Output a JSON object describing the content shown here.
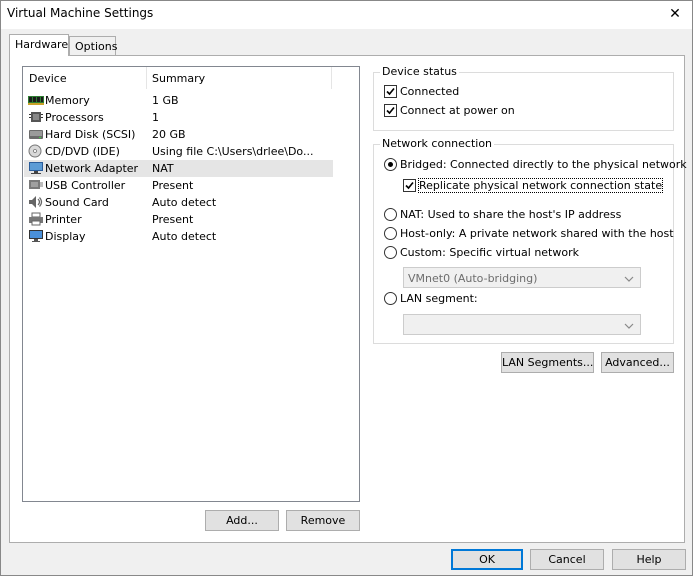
{
  "window": {
    "title": "Virtual Machine Settings",
    "close_glyph": "✕"
  },
  "tabs": [
    {
      "label": "Hardware",
      "active": true
    },
    {
      "label": "Options",
      "active": false
    }
  ],
  "device_list": {
    "columns": [
      "Device",
      "Summary"
    ],
    "rows": [
      {
        "device": "Memory",
        "summary": "1 GB",
        "icon": "memory-icon"
      },
      {
        "device": "Processors",
        "summary": "1",
        "icon": "processor-icon"
      },
      {
        "device": "Hard Disk (SCSI)",
        "summary": "20 GB",
        "icon": "hard-disk-icon"
      },
      {
        "device": "CD/DVD (IDE)",
        "summary": "Using file C:\\Users\\drlee\\Do...",
        "icon": "cd-dvd-icon"
      },
      {
        "device": "Network Adapter",
        "summary": "NAT",
        "icon": "network-adapter-icon",
        "selected": true
      },
      {
        "device": "USB Controller",
        "summary": "Present",
        "icon": "usb-controller-icon"
      },
      {
        "device": "Sound Card",
        "summary": "Auto detect",
        "icon": "sound-card-icon"
      },
      {
        "device": "Printer",
        "summary": "Present",
        "icon": "printer-icon"
      },
      {
        "device": "Display",
        "summary": "Auto detect",
        "icon": "display-icon"
      }
    ],
    "add_label": "Add...",
    "remove_label": "Remove"
  },
  "device_status": {
    "title": "Device status",
    "connected": {
      "label": "Connected",
      "checked": true
    },
    "connect_at_power_on": {
      "label": "Connect at power on",
      "checked": true
    }
  },
  "network_connection": {
    "title": "Network connection",
    "bridged": {
      "label": "Bridged: Connected directly to the physical network",
      "selected": true
    },
    "replicate": {
      "label": "Replicate physical network connection state",
      "checked": true
    },
    "nat": {
      "label": "NAT: Used to share the host's IP address",
      "selected": false
    },
    "host_only": {
      "label": "Host-only: A private network shared with the host",
      "selected": false
    },
    "custom": {
      "label": "Custom: Specific virtual network",
      "selected": false
    },
    "custom_select": "VMnet0 (Auto-bridging)",
    "lan_segment": {
      "label": "LAN segment:",
      "selected": false
    },
    "lan_segment_select": ""
  },
  "buttons": {
    "lan_segments": "LAN Segments...",
    "advanced": "Advanced...",
    "ok": "OK",
    "cancel": "Cancel",
    "help": "Help"
  }
}
